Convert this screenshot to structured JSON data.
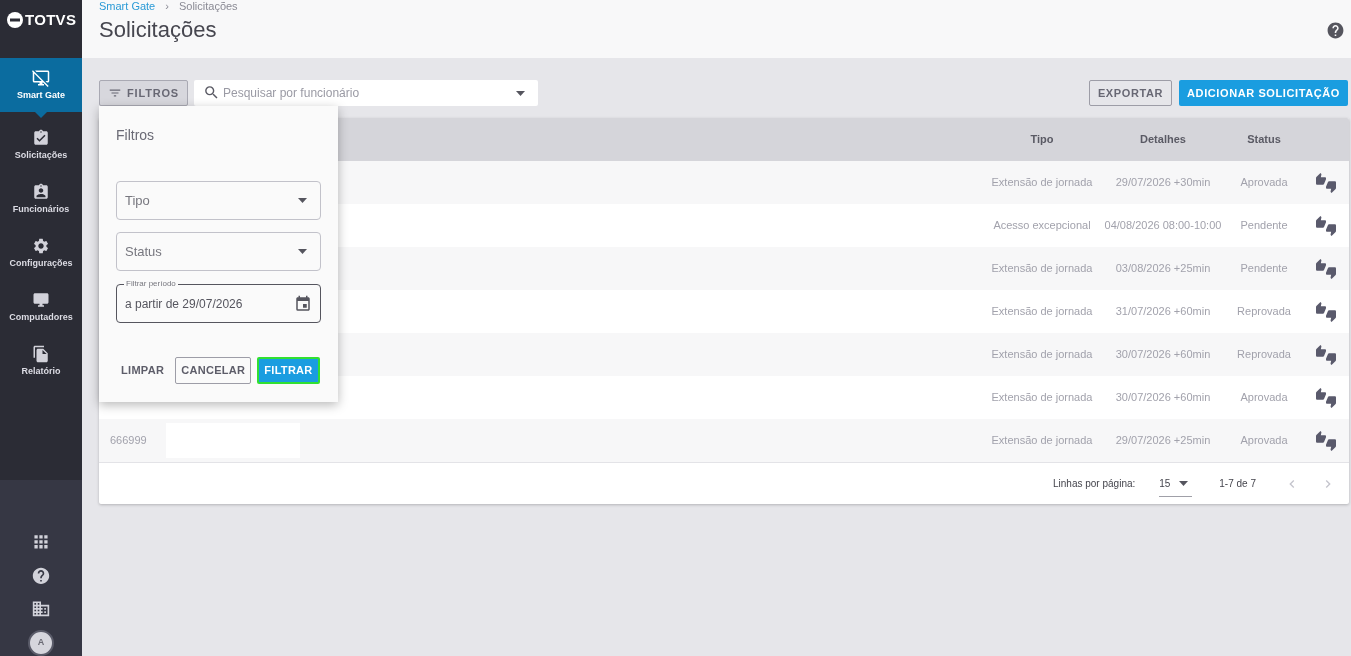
{
  "sidebar": {
    "logo": "TOTVS",
    "items": [
      {
        "label": "Smart Gate",
        "selected": true
      },
      {
        "label": "Solicitações",
        "selected": false
      },
      {
        "label": "Funcionários",
        "selected": false
      },
      {
        "label": "Configurações",
        "selected": false
      },
      {
        "label": "Computadores",
        "selected": false
      },
      {
        "label": "Relatório",
        "selected": false
      }
    ],
    "avatar": "A"
  },
  "header": {
    "breadcrumb": [
      {
        "label": "Smart Gate",
        "kind": "link"
      },
      {
        "label": "Solicitações",
        "kind": "current"
      }
    ],
    "separator": "›",
    "title": "Solicitações"
  },
  "toolbar": {
    "filter_button": {
      "label": "FILTROS",
      "active": true
    },
    "search": {
      "placeholder": "Pesquisar por funcionário"
    },
    "buttons": [
      {
        "label": "EXPORTAR",
        "kind": "outlined"
      },
      {
        "label": "ADICIONAR SOLICITAÇÃO",
        "kind": "contained"
      }
    ]
  },
  "filter_popover": {
    "title": "Filtros",
    "selects": [
      {
        "label": "Tipo"
      },
      {
        "label": "Status"
      }
    ],
    "period": {
      "label": "Filtrar período",
      "value": "a partir de 29/07/2026"
    },
    "buttons": [
      {
        "label": "LIMPAR",
        "kind": "text",
        "highlighted": false
      },
      {
        "label": "CANCELAR",
        "kind": "outlined",
        "highlighted": false
      },
      {
        "label": "FILTRAR",
        "kind": "contained",
        "highlighted": true
      }
    ]
  },
  "table": {
    "columns": [
      "Tipo",
      "Detalhes",
      "Status"
    ],
    "rows": [
      {
        "cells": [
          "Extensão de jornada",
          "29/07/2026 +30min",
          "Aprovada"
        ]
      },
      {
        "cells": [
          "Acesso excepcional",
          "04/08/2026 08:00-10:00",
          "Pendente"
        ]
      },
      {
        "cells": [
          "Extensão de jornada",
          "03/08/2026 +25min",
          "Pendente"
        ]
      },
      {
        "cells": [
          "Extensão de jornada",
          "31/07/2026 +60min",
          "Reprovada"
        ]
      },
      {
        "cells": [
          "Extensão de jornada",
          "30/07/2026 +60min",
          "Reprovada"
        ]
      },
      {
        "cells": [
          "Extensão de jornada",
          "30/07/2026 +60min",
          "Aprovada"
        ]
      },
      {
        "code": "666999",
        "name_redacted": true,
        "cells": [
          "Extensão de jornada",
          "29/07/2026 +25min",
          "Aprovada"
        ]
      }
    ]
  },
  "pagination": {
    "rows_per_page_label": "Linhas por página:",
    "rows_per_page": "15",
    "range": "1-7 de 7",
    "previous_disabled": true,
    "next_disabled": true
  }
}
